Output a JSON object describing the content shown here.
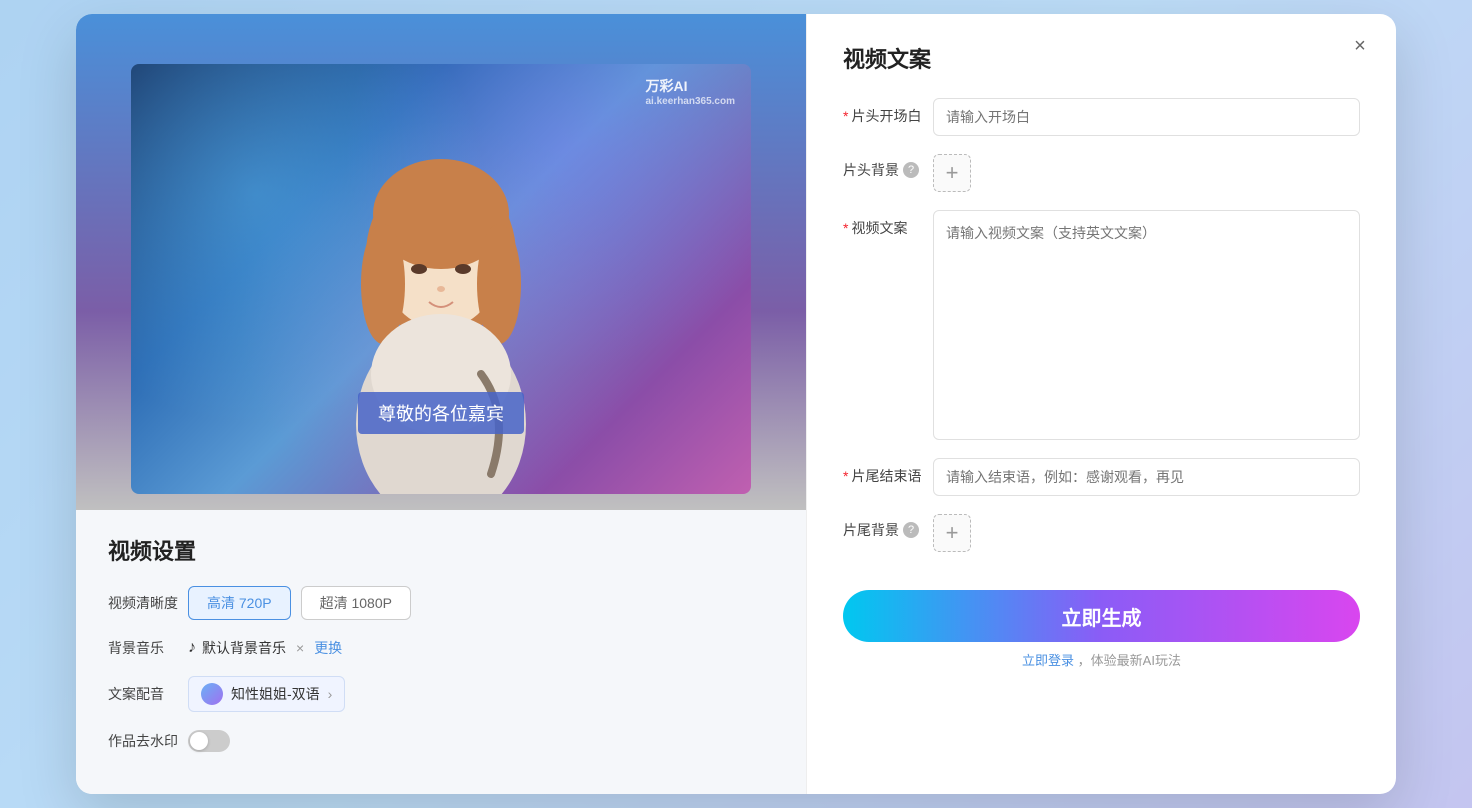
{
  "modal": {
    "close_label": "×",
    "left": {
      "subtitle": "尊敬的各位嘉宾",
      "watermark": "万彩AI",
      "watermark_sub": "ai.keerhan365.com",
      "settings_title": "视频设置",
      "resolution_label": "视频清晰度",
      "resolution_options": [
        {
          "label": "高清 720P",
          "active": true
        },
        {
          "label": "超清 1080P",
          "active": false
        }
      ],
      "music_label": "背景音乐",
      "music_icon": "♪",
      "music_name": "默认背景音乐",
      "music_close": "×",
      "music_replace": "更换",
      "voice_label": "文案配音",
      "voice_name": "知性姐姐-双语",
      "watermark_label": "作品去水印"
    },
    "right": {
      "panel_title": "视频文案",
      "opening_label": "片头开场白",
      "opening_required": "*",
      "opening_placeholder": "请输入开场白",
      "bg_head_label": "片头背景",
      "bg_help": "?",
      "add_icon": "+",
      "copy_label": "视频文案",
      "copy_required": "*",
      "copy_placeholder": "请输入视频文案（支持英文文案）",
      "ending_label": "片尾结束语",
      "ending_required": "*",
      "ending_placeholder": "请输入结束语，例如：感谢观看，再见",
      "bg_tail_label": "片尾背景",
      "bg_tail_help": "?",
      "generate_btn": "立即生成",
      "login_hint": "立即登录，体验最新AI玩法"
    }
  }
}
